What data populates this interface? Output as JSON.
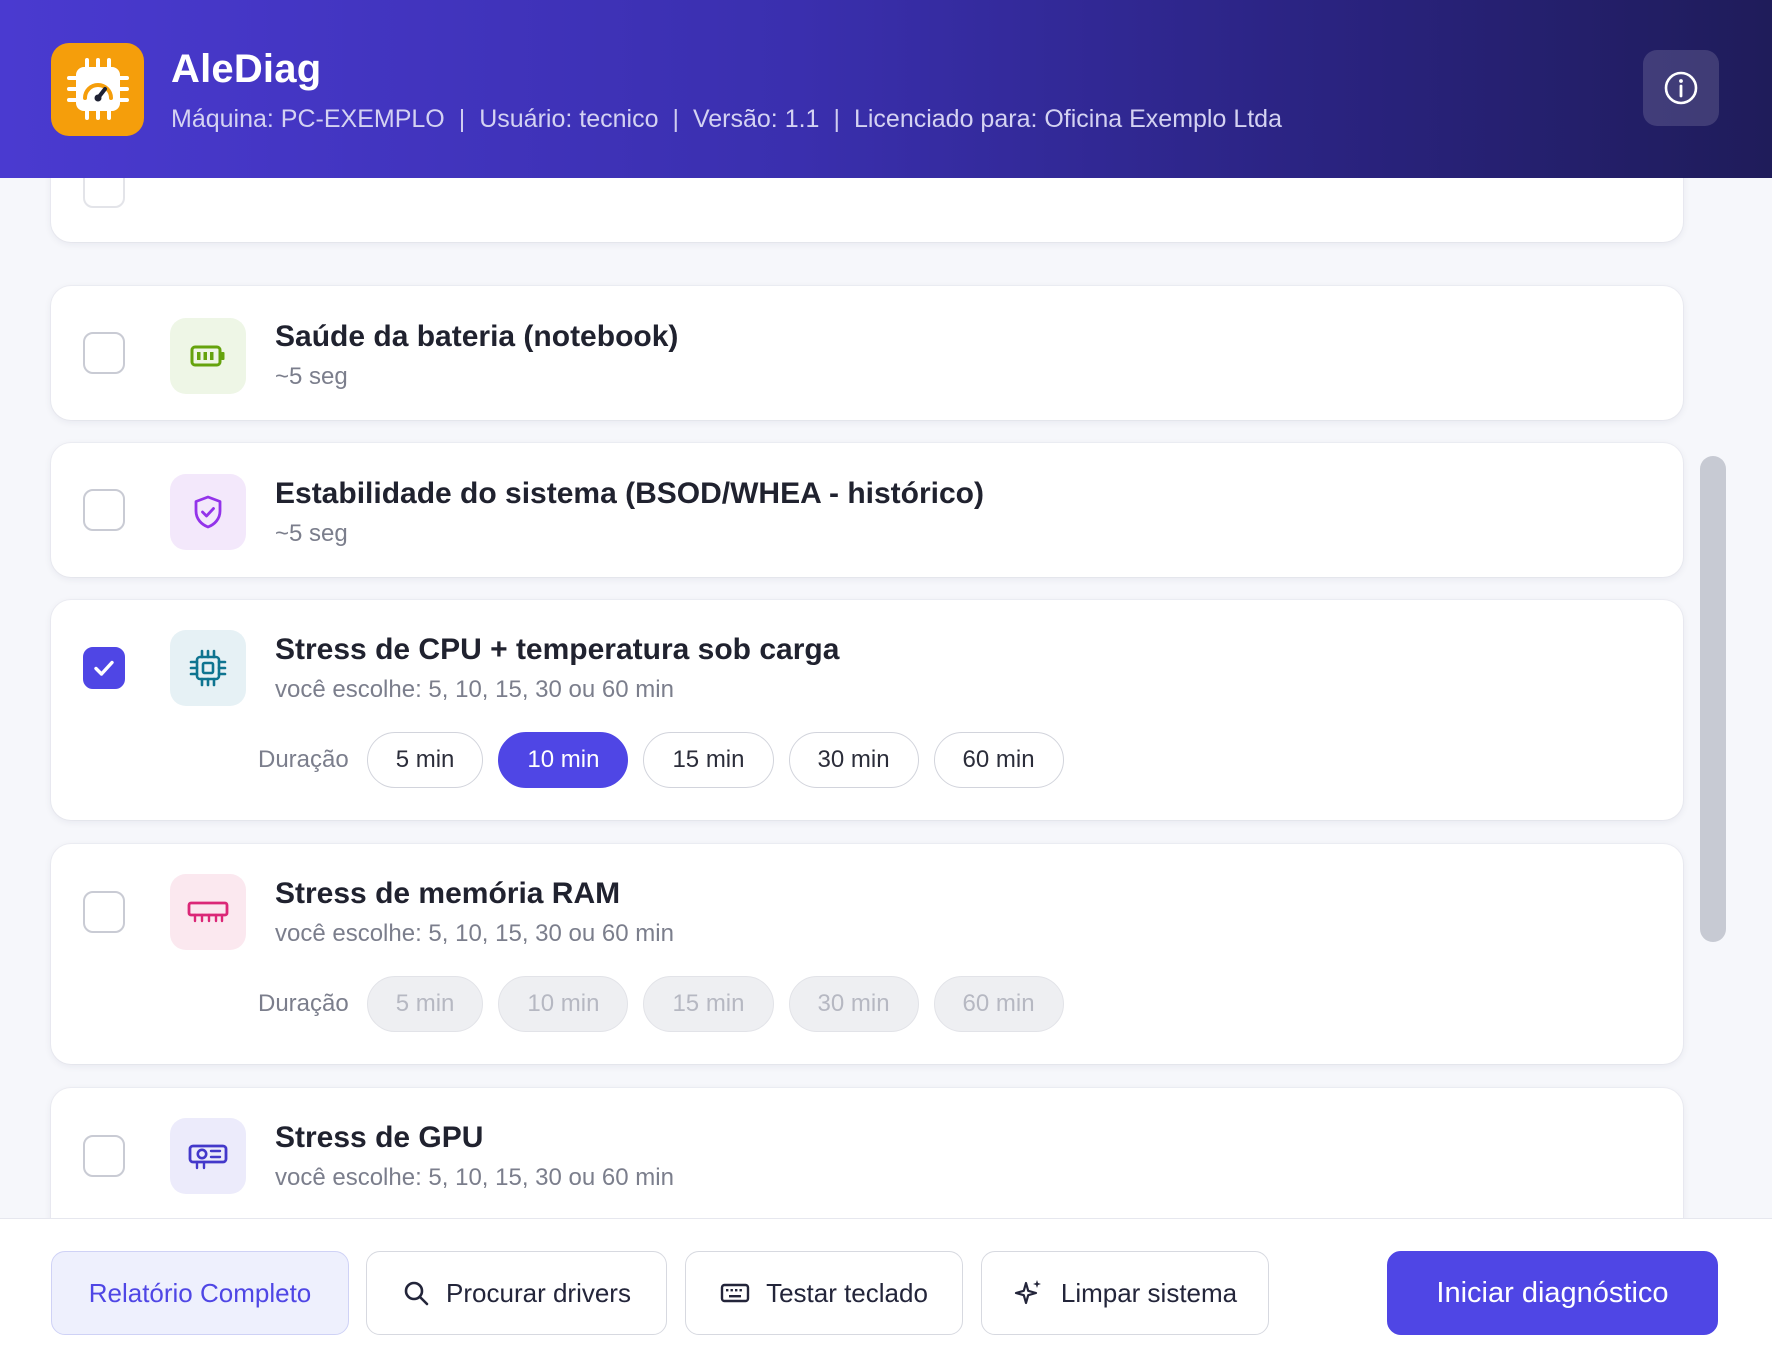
{
  "header": {
    "title": "AleDiag",
    "machine": "Máquina: PC-EXEMPLO",
    "user": "Usuário: tecnico",
    "version": "Versão: 1.1",
    "license": "Licenciado para: Oficina Exemplo Ltda",
    "separator": "|",
    "logo_icon": "chip-gauge-icon",
    "info_icon": "info-icon"
  },
  "tests": [
    {
      "title": "Saúde da bateria (notebook)",
      "subtitle": "~5 seg",
      "checked": false,
      "icon": "battery-icon",
      "icon_color": "#65a30d",
      "icon_bg": "#eef6e6"
    },
    {
      "title": "Estabilidade do sistema (BSOD/WHEA - histórico)",
      "subtitle": "~5 seg",
      "checked": false,
      "icon": "shield-check-icon",
      "icon_color": "#9333ea",
      "icon_bg": "#f3e8fb"
    },
    {
      "title": "Stress de CPU + temperatura sob carga",
      "subtitle": "você escolhe: 5, 10, 15, 30 ou 60 min",
      "checked": true,
      "icon": "cpu-icon",
      "icon_color": "#0e7490",
      "icon_bg": "#e6f1f5",
      "duration_label": "Duração",
      "durations": [
        "5 min",
        "10 min",
        "15 min",
        "30 min",
        "60 min"
      ],
      "selected_duration": "10 min"
    },
    {
      "title": "Stress de memória RAM",
      "subtitle": "você escolhe: 5, 10, 15, 30 ou 60 min",
      "checked": false,
      "icon": "memory-icon",
      "icon_color": "#db2777",
      "icon_bg": "#fbe8ef",
      "duration_label": "Duração",
      "durations": [
        "5 min",
        "10 min",
        "15 min",
        "30 min",
        "60 min"
      ],
      "durations_disabled": true
    },
    {
      "title": "Stress de GPU",
      "subtitle": "você escolhe: 5, 10, 15, 30 ou 60 min",
      "checked": false,
      "icon": "gpu-icon",
      "icon_color": "#4338ca",
      "icon_bg": "#ecebfb"
    }
  ],
  "footer": {
    "report_label": "Relatório Completo",
    "drivers_label": "Procurar drivers",
    "keyboard_label": "Testar teclado",
    "clean_label": "Limpar sistema",
    "start_label": "Iniciar diagnóstico"
  },
  "colors": {
    "accent": "#4f46e5",
    "logo_bg": "#f59e0b"
  }
}
